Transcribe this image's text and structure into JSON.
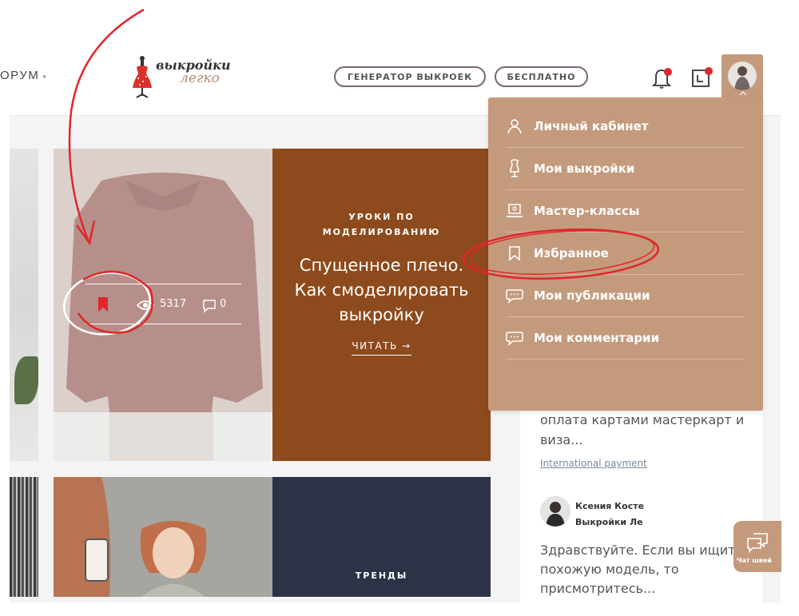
{
  "header": {
    "nav_forum": "ОРУМ",
    "logo_line1": "выкройки",
    "logo_line2": "легко",
    "generator_button": "ГЕНЕРАТОР ВЫКРОЕК",
    "free_button": "БЕСПЛАТНО"
  },
  "card1": {
    "category_line1": "УРОКИ ПО",
    "category_line2": "МОДЕЛИРОВАНИЮ",
    "title_line1": "Спущенное плечо.",
    "title_line2": "Как смоделировать",
    "title_line3": "выкройку",
    "read_label": "ЧИТАТЬ →",
    "views": "5317",
    "comments": "0"
  },
  "card2": {
    "category": "ТРЕНДЫ"
  },
  "sidebar": {
    "text1": "оплата картами мастеркарт и виза...",
    "link": "International payment",
    "author_line1": "Ксения Косте",
    "author_line2": "Выкройки Ле",
    "text2": "Здравствуйте. Если вы ищите похожую модель, то присмотритесь..."
  },
  "chat_button": {
    "label": "Чат швей"
  },
  "dropdown": {
    "items": [
      {
        "label": "Личный кабинет",
        "icon": "user-icon"
      },
      {
        "label": "Мои выкройки",
        "icon": "mannequin-icon"
      },
      {
        "label": "Мастер-классы",
        "icon": "laptop-icon"
      },
      {
        "label": "Избранное",
        "icon": "bookmark-icon"
      },
      {
        "label": "Мои публикации",
        "icon": "chat-bubble-icon"
      },
      {
        "label": "Мои комментарии",
        "icon": "chat-bubble-icon"
      }
    ]
  },
  "colors": {
    "accent": "#c49a7c",
    "card1_panel": "#8d4a1c",
    "card2_panel": "#2c3347",
    "annotation_red": "#e0262a"
  }
}
